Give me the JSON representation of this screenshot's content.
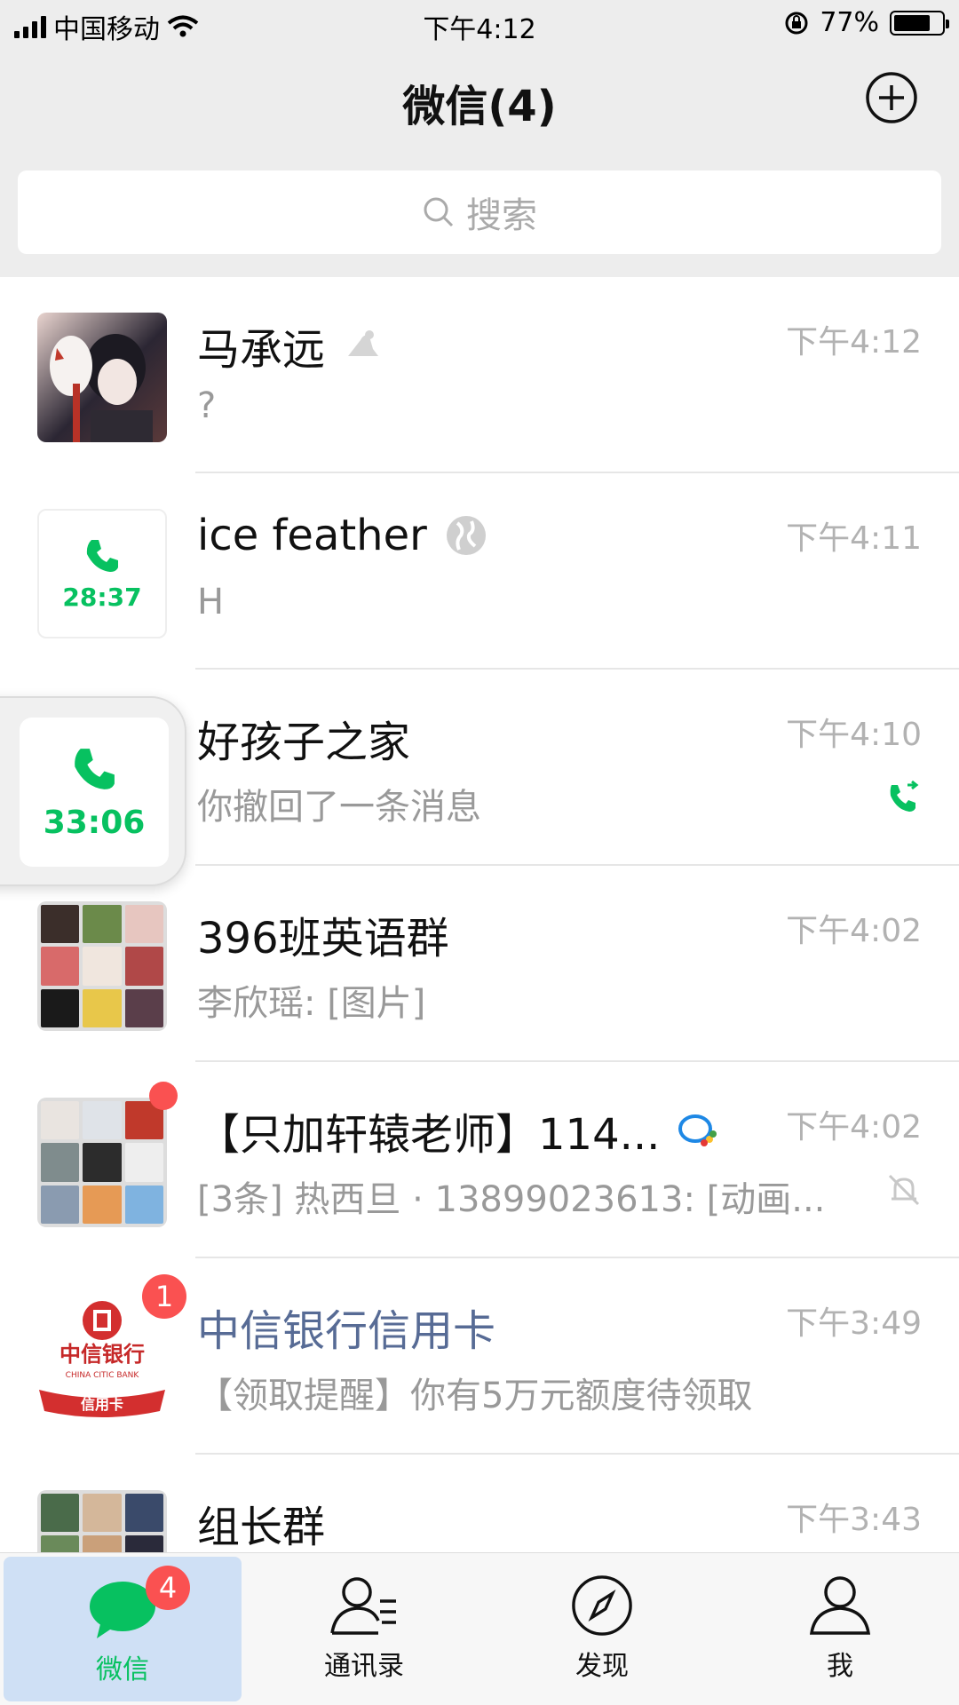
{
  "status_bar": {
    "carrier": "中国移动",
    "time": "下午4:12",
    "battery": "77%"
  },
  "header": {
    "title": "微信(4)",
    "add_icon": "plus-circle-icon"
  },
  "search": {
    "placeholder": "搜索"
  },
  "chats": [
    {
      "name": "马承远",
      "time": "下午4:12",
      "message": "?",
      "icon": "sign-icon"
    },
    {
      "name": "ice feather",
      "time": "下午4:11",
      "message": "H",
      "call_timer": "28:37",
      "icon": "globe-icon"
    },
    {
      "name": "好孩子之家",
      "time": "下午4:10",
      "message": "你撤回了一条消息",
      "icon": "phone-call-icon"
    },
    {
      "name": "396班英语群",
      "time": "下午4:02",
      "message": "李欣瑶: [图片]"
    },
    {
      "name": "【只加轩辕老师】114...",
      "time": "下午4:02",
      "message": "[3条] 热西旦 · 13899023613: [动画...",
      "icon": "muted-bell-icon"
    },
    {
      "name": "中信银行信用卡",
      "time": "下午3:49",
      "message": "【领取提醒】你有5万元额度待领取",
      "badge": "1",
      "logo_text": {
        "cn": "中信银行",
        "en": "CHINA CITIC BANK",
        "card": "信用卡"
      }
    },
    {
      "name": "组长群",
      "time": "下午3:43",
      "message": ""
    }
  ],
  "floating_call": {
    "timer": "33:06"
  },
  "tabbar": {
    "tabs": [
      {
        "label": "微信",
        "badge": "4"
      },
      {
        "label": "通讯录"
      },
      {
        "label": "发现"
      },
      {
        "label": "我"
      }
    ]
  },
  "colors": {
    "accent": "#07c160",
    "badge": "#fa5151",
    "link_name": "#576b95"
  }
}
